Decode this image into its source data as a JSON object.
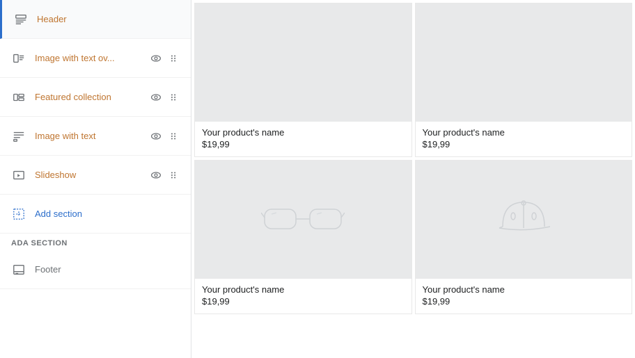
{
  "sidebar": {
    "items": [
      {
        "id": "header",
        "label": "Header",
        "icon": "header-icon",
        "active": true,
        "showActions": false,
        "labelColor": "orange"
      },
      {
        "id": "image-with-text-ov",
        "label": "Image with text ov...",
        "icon": "image-text-icon",
        "active": false,
        "showActions": true,
        "labelColor": "orange"
      },
      {
        "id": "featured-collection",
        "label": "Featured collection",
        "icon": "featured-icon",
        "active": false,
        "showActions": true,
        "labelColor": "orange"
      },
      {
        "id": "image-with-text",
        "label": "Image with text",
        "icon": "image-text2-icon",
        "active": false,
        "showActions": true,
        "labelColor": "orange"
      },
      {
        "id": "slideshow",
        "label": "Slideshow",
        "icon": "slideshow-icon",
        "active": false,
        "showActions": true,
        "labelColor": "orange"
      },
      {
        "id": "add-section",
        "label": "Add section",
        "icon": "add-section-icon",
        "active": false,
        "showActions": false,
        "labelColor": "blue"
      },
      {
        "id": "footer",
        "label": "Footer",
        "icon": "footer-icon",
        "active": false,
        "showActions": false,
        "labelColor": "grey"
      }
    ],
    "section_labels": {
      "ada_section": "Ada section"
    }
  },
  "products": [
    {
      "id": 1,
      "name": "Your product's name",
      "price": "$19,99",
      "type": "top-right",
      "placeholder": "none"
    },
    {
      "id": 2,
      "name": "Your product's name",
      "price": "$19,99",
      "type": "top-left",
      "placeholder": "none"
    },
    {
      "id": 3,
      "name": "Your product's name",
      "price": "$19,99",
      "type": "bottom-left",
      "placeholder": "glasses"
    },
    {
      "id": 4,
      "name": "Your product's name",
      "price": "$19,99",
      "type": "bottom-right",
      "placeholder": "hat"
    }
  ]
}
